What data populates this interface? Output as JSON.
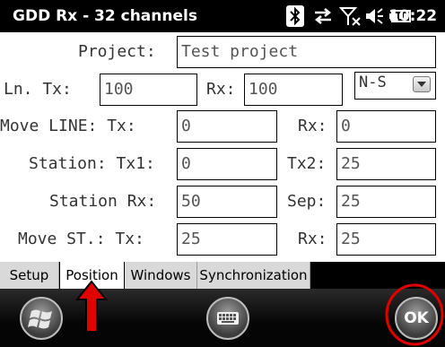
{
  "titlebar": {
    "title": "GDD Rx - 32 channels",
    "clock": "10:22",
    "status_icons": [
      "bluetooth-icon",
      "sync-icon",
      "signal-off-icon",
      "volume-icon",
      "battery-icon"
    ]
  },
  "form": {
    "project_label": "Project:",
    "project_value": "Test project",
    "ln_tx_label": "Ln. Tx:",
    "ln_tx_value": "100",
    "ln_rx_label": "Rx:",
    "ln_rx_value": "100",
    "direction_value": "N-S",
    "move_line_tx_label": "Move LINE: Tx:",
    "move_line_tx_value": "0",
    "move_line_rx_label": "Rx:",
    "move_line_rx_value": "0",
    "station_tx1_label": "Station: Tx1:",
    "station_tx1_value": "0",
    "station_tx2_label": "Tx2:",
    "station_tx2_value": "25",
    "station_rx_label": "Station Rx:",
    "station_rx_value": "50",
    "sep_label": "Sep:",
    "sep_value": "25",
    "move_st_tx_label": "Move ST.: Tx:",
    "move_st_tx_value": "25",
    "move_st_rx_label": "Rx:",
    "move_st_rx_value": "25"
  },
  "tabs": [
    {
      "label": "Setup"
    },
    {
      "label": "Position",
      "active": true
    },
    {
      "label": "Windows"
    },
    {
      "label": "Synchronization"
    }
  ],
  "bottombar": {
    "ok_label": "OK"
  },
  "colors": {
    "bar": "#000000",
    "annotation": "#e00000",
    "field_border": "#000000"
  }
}
